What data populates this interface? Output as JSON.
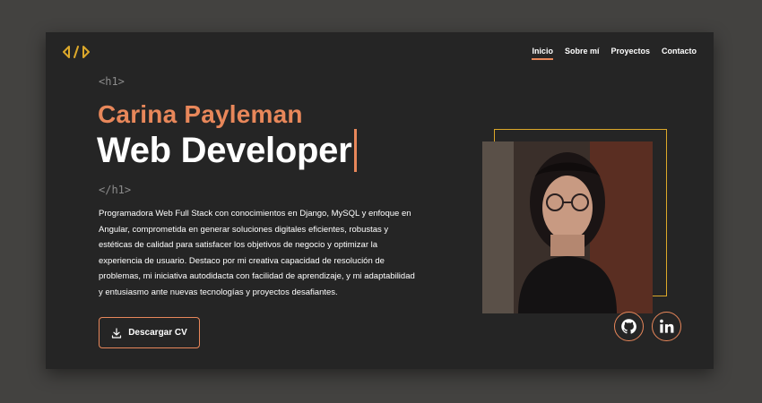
{
  "nav": {
    "items": [
      {
        "label": "Inicio",
        "active": true
      },
      {
        "label": "Sobre mí",
        "active": false
      },
      {
        "label": "Proyectos",
        "active": false
      },
      {
        "label": "Contacto",
        "active": false
      }
    ]
  },
  "hero": {
    "open_tag": "<h1>",
    "close_tag": "</h1>",
    "name": "Carina Payleman",
    "role": "Web Developer",
    "description": "Programadora Web Full Stack con conocimientos en Django, MySQL y enfoque en Angular, comprometida en generar soluciones digitales eficientes, robustas y estéticas de calidad para satisfacer los objetivos de negocio y optimizar la experiencia de usuario. Destaco por mi creativa capacidad de resolución de problemas, mi iniciativa autodidacta con facilidad de aprendizaje, y mi adaptabilidad y entusiasmo ante nuevas tecnologías y proyectos desafiantes.",
    "cv_button": "Descargar CV"
  },
  "social": {
    "github_icon": "github-icon",
    "linkedin_icon": "linkedin-icon"
  },
  "colors": {
    "accent": "#e8875a",
    "frame": "#dca82a",
    "background": "#252525",
    "page": "#434240"
  }
}
